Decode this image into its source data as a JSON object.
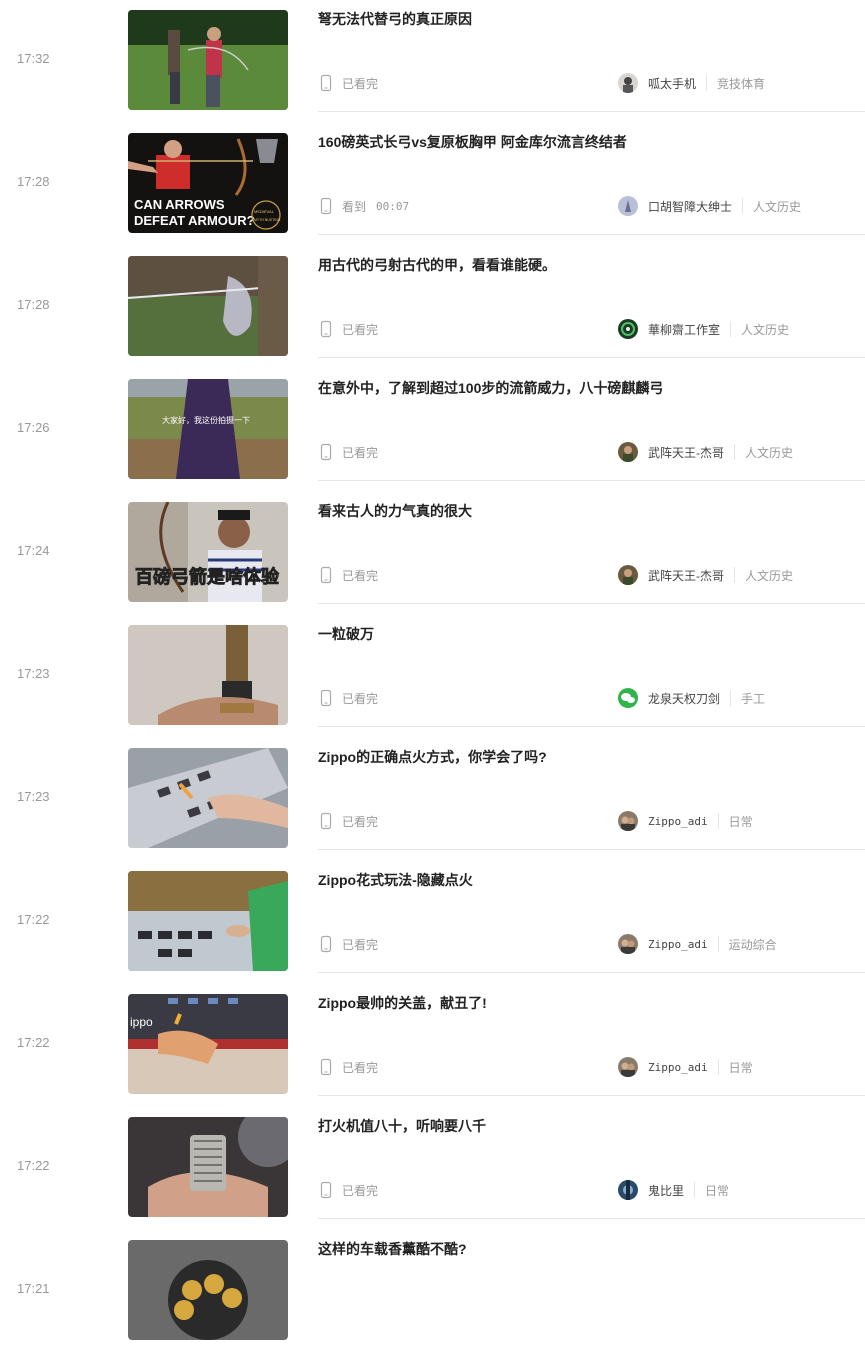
{
  "history": {
    "items": [
      {
        "time": "17:32",
        "title": "弩无法代替弓的真正原因",
        "progress": "已看完",
        "position": "",
        "author": "呱太手机",
        "tag": "竞技体育",
        "mono": false
      },
      {
        "time": "17:28",
        "title": "160磅英式长弓vs复原板胸甲 阿金库尔流言终结者",
        "progress": "看到",
        "position": "00:07",
        "author": "口胡智障大绅士",
        "tag": "人文历史",
        "mono": false,
        "thumb_text_1": "CAN ARROWS",
        "thumb_text_2": "DEFEAT ARMOUR?",
        "thumb_badge_1": "MEDIEVAL",
        "thumb_badge_2": "MYTH BUSTING"
      },
      {
        "time": "17:28",
        "title": "用古代的弓射古代的甲，看看谁能硬。",
        "progress": "已看完",
        "position": "",
        "author": "華柳齋工作室",
        "tag": "人文历史",
        "mono": false
      },
      {
        "time": "17:26",
        "title": "在意外中，了解到超过100步的流箭威力，八十磅麒麟弓",
        "progress": "已看完",
        "position": "",
        "author": "武阵天王-杰哥",
        "tag": "人文历史",
        "mono": false,
        "thumb_caption": "大家好，我这份拍摄一下"
      },
      {
        "time": "17:24",
        "title": "看来古人的力气真的很大",
        "progress": "已看完",
        "position": "",
        "author": "武阵天王-杰哥",
        "tag": "人文历史",
        "mono": false,
        "thumb_caption": "百磅弓箭是啥体验"
      },
      {
        "time": "17:23",
        "title": "一粒破万",
        "progress": "已看完",
        "position": "",
        "author": "龙泉天权刀剑",
        "tag": "手工",
        "mono": false
      },
      {
        "time": "17:23",
        "title": "Zippo的正确点火方式，你学会了吗?",
        "progress": "已看完",
        "position": "",
        "author": "Zippo_adi",
        "tag": "日常",
        "mono": true
      },
      {
        "time": "17:22",
        "title": "Zippo花式玩法-隐藏点火",
        "progress": "已看完",
        "position": "",
        "author": "Zippo_adi",
        "tag": "运动综合",
        "mono": true
      },
      {
        "time": "17:22",
        "title": "Zippo最帅的关盖，献丑了!",
        "progress": "已看完",
        "position": "",
        "author": "Zippo_adi",
        "tag": "日常",
        "mono": true,
        "thumb_caption": "ippo"
      },
      {
        "time": "17:22",
        "title": "打火机值八十，听响要八千",
        "progress": "已看完",
        "position": "",
        "author": "鬼比里",
        "tag": "日常",
        "mono": false
      },
      {
        "time": "17:21",
        "title": "这样的车载香薰酷不酷?",
        "progress": "",
        "position": "",
        "author": "",
        "tag": "",
        "mono": false
      }
    ]
  },
  "colors": {
    "time": "#999999",
    "divider": "#e8e8e8",
    "title": "#222222"
  },
  "icons": {
    "device": "phone-icon"
  }
}
